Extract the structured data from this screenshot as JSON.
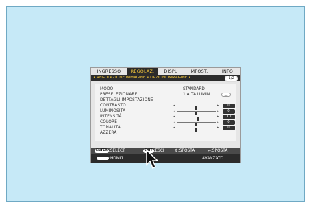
{
  "tabs": [
    {
      "label": "INGRESSO",
      "active": false
    },
    {
      "label": "REGOLAZ.",
      "active": true
    },
    {
      "label": "DISPL",
      "active": false
    },
    {
      "label": "IMPOST.",
      "active": false
    },
    {
      "label": "INFO",
      "active": false
    }
  ],
  "breadcrumb": {
    "item1": "REGOLAZIONE IMMAGINE",
    "item2": "OPZIONI IMMAGINE",
    "page": "1/2"
  },
  "settings": {
    "modo": {
      "label": "MODO",
      "value": "STANDARD"
    },
    "preselezionare": {
      "label": "PRESELEZIONARE",
      "value": "1:ALTA LUMIN."
    },
    "dettagli": {
      "label": "DETTAGLI IMPOSTAZIONE"
    },
    "contrasto": {
      "label": "CONTRASTO",
      "value": "0",
      "level": 0.5
    },
    "luminosita": {
      "label": "LUMINOSITÀ",
      "value": "0",
      "level": 0.5
    },
    "intensita": {
      "label": "INTENSITÀ",
      "value": "10",
      "level": 0.55
    },
    "colore": {
      "label": "COLORE",
      "value": "0",
      "level": 0.5
    },
    "tonalita": {
      "label": "TONALITÀ",
      "value": "0",
      "level": 0.5
    },
    "azzera": {
      "label": "AZZERA"
    }
  },
  "footer": {
    "enter_key": "ENTER",
    "select": ":SELECT",
    "exit_key": "EXIT",
    "esci": ":ESCI",
    "updown": "⇕:SPOSTA",
    "leftright": "↔:SPOSTA",
    "source_key": "",
    "source": ":HDMI1",
    "level": "AVANZATO"
  },
  "colors": {
    "background": "#c6e9f7",
    "menu_bg": "#e6e6e6",
    "active_tab": "#2b2b2b",
    "highlight": "#f2c53b"
  }
}
